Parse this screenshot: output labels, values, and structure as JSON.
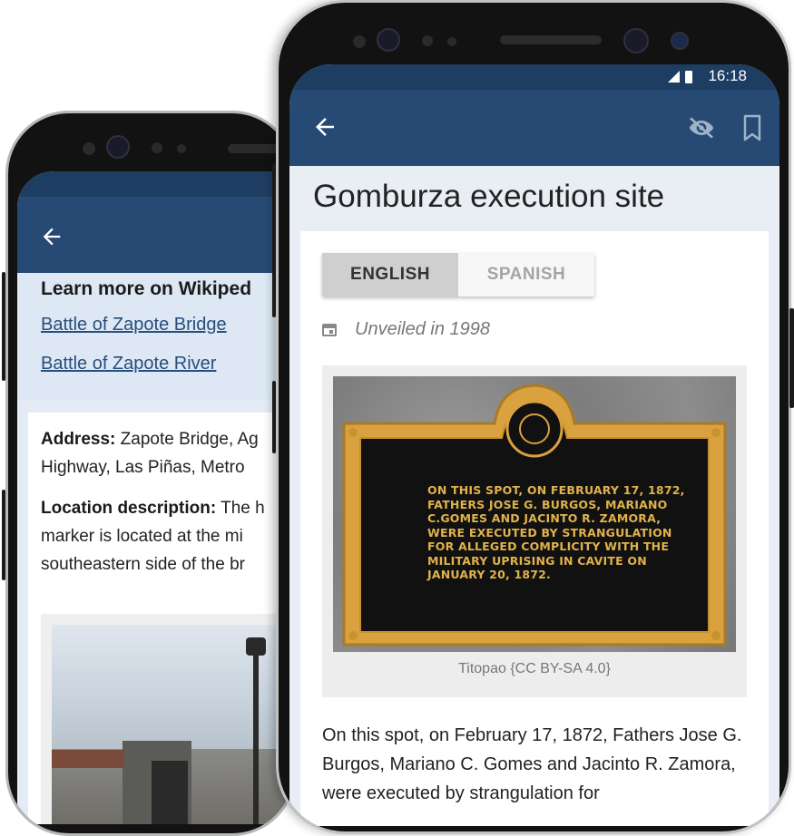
{
  "back_screen": {
    "wiki_title": "Learn more on Wikiped",
    "links": [
      "Battle of Zapote Bridge",
      "Battle of Zapote River"
    ],
    "address_label": "Address:",
    "address_line1": "Zapote Bridge, Ag",
    "address_line2": "Highway, Las Piñas, Metro",
    "location_label": "Location description:",
    "location_line1": "The h",
    "location_line2": "marker is located at the mi",
    "location_line3": "southeastern side of the br"
  },
  "status_bar": {
    "time": "16:18"
  },
  "app_bar": {
    "back_icon": "arrow-left-icon",
    "hide_icon": "eye-off-icon",
    "bookmark_icon": "bookmark-icon",
    "color": "#264a74"
  },
  "page": {
    "title": "Gomburza execution site",
    "languages": {
      "selected": "ENGLISH",
      "other": "SPANISH"
    },
    "unveiled": "Unveiled in 1998",
    "plaque_text": [
      "ON THIS SPOT, ON FEBRUARY 17, 1872,",
      "FATHERS JOSE G. BURGOS, MARIANO",
      "C.GOMES AND JACINTO R. ZAMORA,",
      "WERE EXECUTED BY STRANGULATION",
      "FOR ALLEGED COMPLICITY WITH THE",
      "MILITARY UPRISING IN CAVITE ON",
      "JANUARY 20, 1872."
    ],
    "photo_caption": "Titopao {CC BY-SA 4.0}",
    "description": "On this spot, on February 17, 1872, Fathers Jose G. Burgos, Mariano C. Gomes and Jacinto R. Zamora, were executed by strangulation for"
  },
  "colors": {
    "primary": "#264a74",
    "status": "#1e3d62",
    "plaque_gold": "#e0b24a"
  }
}
